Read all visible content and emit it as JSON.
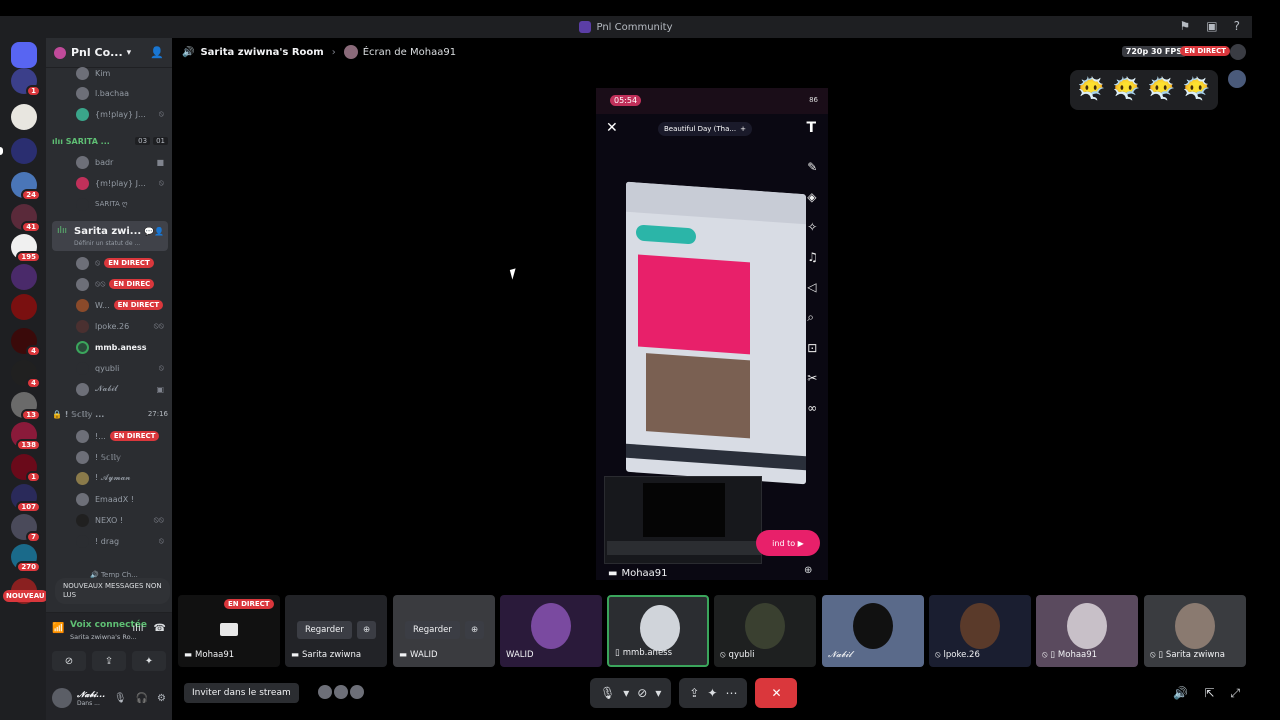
{
  "window": {
    "title": "Pnl Community"
  },
  "server": {
    "name": "Pnl Co..."
  },
  "guild_badges": [
    "1",
    "",
    "",
    "24",
    "41",
    "195",
    "",
    "",
    "4",
    "4",
    "13",
    "138",
    "1",
    "107",
    "7",
    "270"
  ],
  "nouveau_label": "NOUVEAU",
  "channel_list": {
    "top_members": [
      {
        "name": "Kim"
      },
      {
        "name": "l.bachaa"
      },
      {
        "name": "{m!play} J..."
      }
    ],
    "voice_channel_1": {
      "name": "SARITA ...",
      "count_a": "03",
      "count_b": "01"
    },
    "vc1_members": [
      {
        "name": "badr"
      },
      {
        "name": "{m!play} J..."
      },
      {
        "name": "SARITA ღ"
      }
    ],
    "active_channel": {
      "name": "Sarita zwi...",
      "status": "Définir un statut de ..."
    },
    "active_members": [
      {
        "name": "",
        "live": "EN DIRECT"
      },
      {
        "name": "",
        "live": "EN DIREC"
      },
      {
        "name": "W...",
        "live": "EN DIRECT"
      },
      {
        "name": "lpoke.26",
        "live": ""
      },
      {
        "name": "mmb.aness",
        "live": ""
      },
      {
        "name": "qyubli",
        "live": ""
      },
      {
        "name": "𝓝𝓪𝓫𝓲𝓵",
        "live": ""
      }
    ],
    "locked_channel": {
      "name": "! 𝕊𝕔𝕝𝕝𝕪 ...",
      "timer": "27:16"
    },
    "locked_members": [
      {
        "name": "!...",
        "live": "EN DIRECT"
      },
      {
        "name": "! 𝕊𝕔𝕝𝕝𝕪 ",
        "live": ""
      },
      {
        "name": "! 𝓐𝔂𝓶𝓪𝓷",
        "live": ""
      },
      {
        "name": "EmaadX !",
        "live": ""
      },
      {
        "name": "NEXO !",
        "live": ""
      },
      {
        "name": "! drag",
        "live": ""
      }
    ],
    "temp_channel": {
      "name": "Temp Ch..."
    },
    "new_messages": "NOUVEAUX MESSAGES NON LUS"
  },
  "voice_panel": {
    "title": "Voix connectée",
    "subtitle": "Sarita zwiwna's Ro..."
  },
  "user_panel": {
    "name": "𝓝𝓪𝓫𝓲...",
    "status": "Dans ..."
  },
  "main": {
    "room": "Sarita zwiwna's Room",
    "screen": "Écran de Mohaa91",
    "fps": "720p 30 FPS",
    "live": "EN DIRECT",
    "emojis": [
      "😶‍🌫️",
      "😶‍🌫️",
      "😶‍🌫️",
      "😶‍🌫️"
    ]
  },
  "stream": {
    "phone_time": "05:54",
    "phone_battery": "86",
    "song": "Beautiful Day (Tha...",
    "pink_button": "ind to",
    "label": "Mohaa91"
  },
  "tiles": [
    {
      "label": "Mohaa91",
      "button": "",
      "live": "EN DIRECT"
    },
    {
      "label": "Sarita zwiwna",
      "button": "Regarder",
      "live": ""
    },
    {
      "label": "WALID",
      "button": "Regarder",
      "live": ""
    },
    {
      "label": "WALID",
      "button": "",
      "live": ""
    },
    {
      "label": "mmb.aness",
      "button": "",
      "live": ""
    },
    {
      "label": "qyubli",
      "button": "",
      "live": ""
    },
    {
      "label": "𝓝𝓪𝓫𝓲𝓵",
      "button": "",
      "live": ""
    },
    {
      "label": "lpoke.26",
      "button": "",
      "live": ""
    },
    {
      "label": "Mohaa91",
      "button": "",
      "live": ""
    },
    {
      "label": "Sarita zwiwna",
      "button": "",
      "live": ""
    }
  ],
  "bottom": {
    "invite": "Inviter dans le stream"
  },
  "colors": {
    "live_red": "#da373c",
    "voice_green": "#5fbf74",
    "background": "#000000",
    "sidebar": "#2b2d31"
  }
}
